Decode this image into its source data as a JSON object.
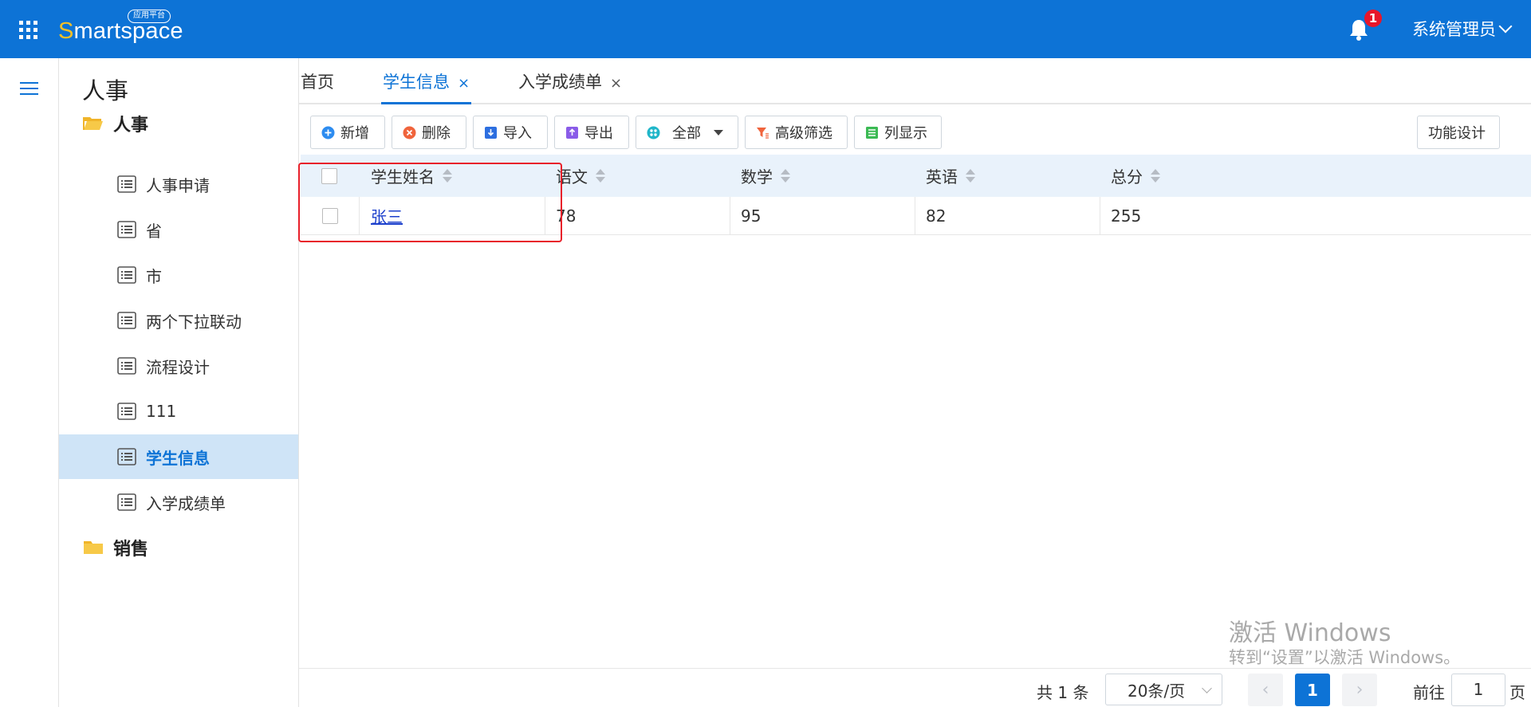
{
  "topbar": {
    "logo_first": "S",
    "logo_rest": "martspace",
    "logo_badge": "应用平台",
    "notifications": "1",
    "user": "系统管理员"
  },
  "sidebar": {
    "title": "人事",
    "group1": "人事",
    "items": [
      "人事申请",
      "省",
      "市",
      "两个下拉联动",
      "流程设计",
      "111",
      "学生信息",
      "入学成绩单"
    ],
    "active_index": 6,
    "group2": "销售"
  },
  "tabs": [
    {
      "label": "首页"
    },
    {
      "label": "学生信息",
      "close": "×"
    },
    {
      "label": "入学成绩单",
      "close": "×"
    }
  ],
  "toolbar": {
    "add": "新增",
    "delete": "删除",
    "import": "导入",
    "export": "导出",
    "scope": "全部",
    "advanced_filter": "高级筛选",
    "columns": "列显示",
    "design": "功能设计"
  },
  "table": {
    "headers": [
      "学生姓名",
      "语文",
      "数学",
      "英语",
      "总分"
    ],
    "rows": [
      [
        "张三",
        "78",
        "95",
        "82",
        "255"
      ]
    ]
  },
  "pagination": {
    "total": "共 1 条",
    "page_size": "20条/页",
    "prev": "‹",
    "current": "1",
    "next": "›",
    "goto_label": "前往",
    "goto_value": "1",
    "page_unit": "页"
  },
  "watermark": {
    "line1": "激活 Windows",
    "line2": "转到“设置”以激活 Windows。"
  },
  "colors": {
    "brand": "#0d73d6",
    "logo_accent": "#f5c027",
    "badge": "#e8162a",
    "annotation": "#e8202a"
  }
}
